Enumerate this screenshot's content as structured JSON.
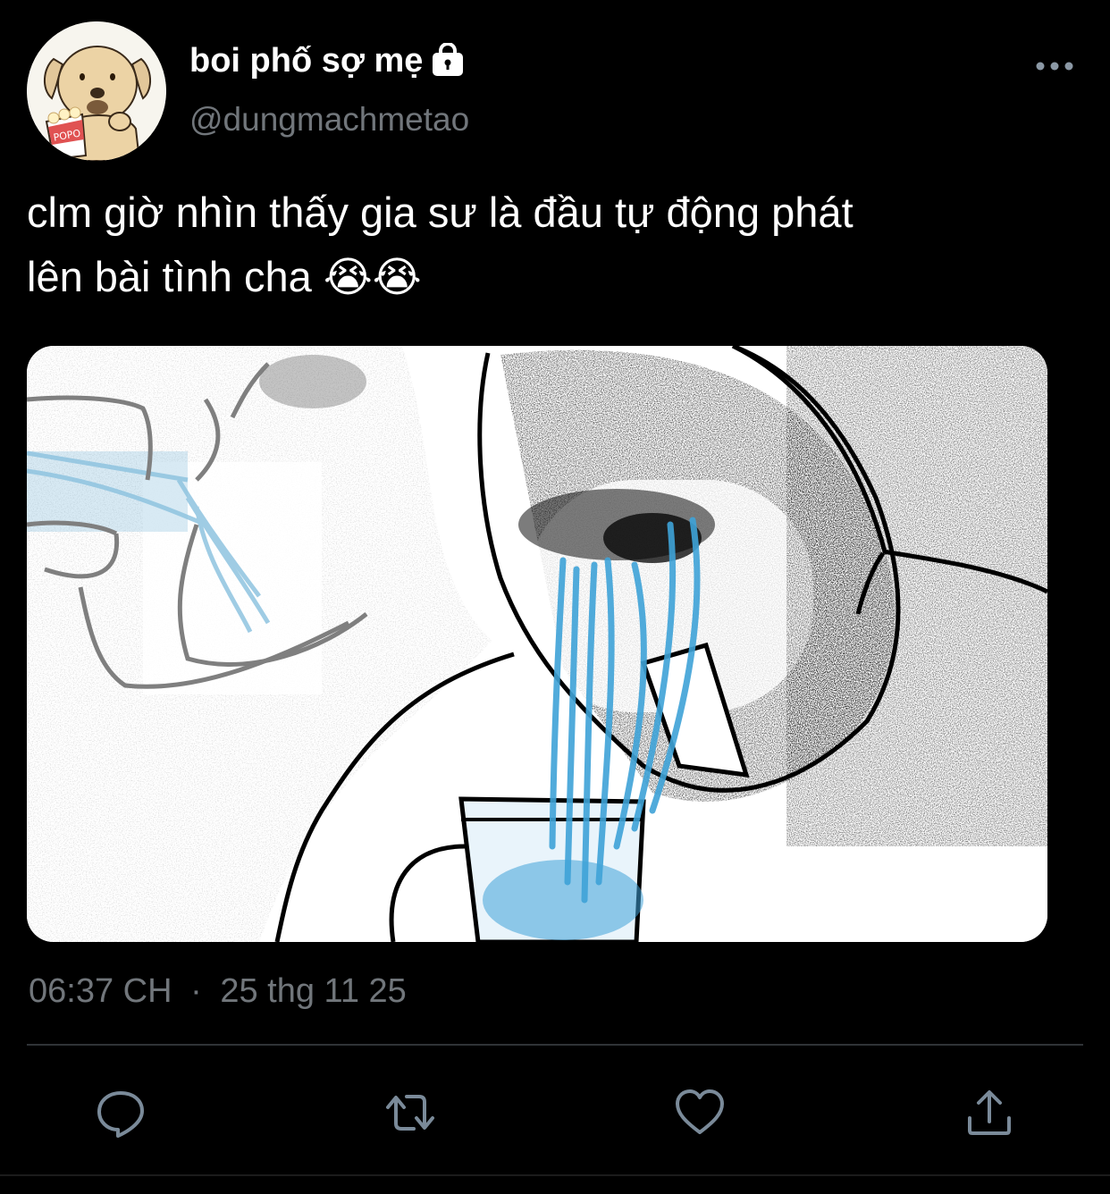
{
  "author": {
    "display_name": "boi phố sợ mẹ",
    "handle": "@dungmachmetao",
    "protected": true,
    "avatar_label": "POPO"
  },
  "tweet": {
    "text": "clm giờ nhìn thấy gia sư là đầu tự động phát\nlên bài tình cha 😭😭",
    "time": "06:37 CH",
    "separator": "·",
    "date": "25 thg 11 25"
  },
  "actions": {
    "reply": "reply-icon",
    "retweet": "retweet-icon",
    "like": "heart-icon",
    "share": "share-icon"
  },
  "colors": {
    "background": "#000000",
    "text_primary": "#ffffff",
    "text_secondary": "#71767b",
    "divider": "#2f3336",
    "icon": "#7a8a99",
    "tear_blue": "#3fa3d8"
  }
}
